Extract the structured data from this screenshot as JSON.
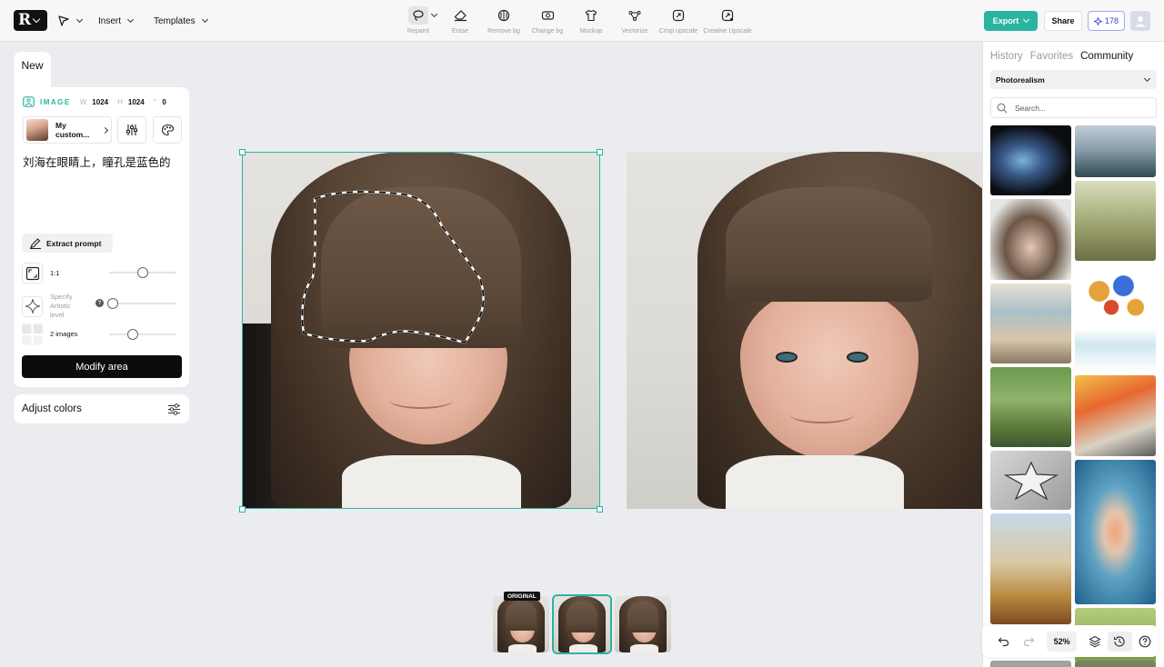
{
  "topbar": {
    "menus": [
      {
        "label": ""
      },
      {
        "label": "Insert"
      },
      {
        "label": "Templates"
      }
    ],
    "tools": [
      {
        "label": "Repaint",
        "icon": "lasso-icon"
      },
      {
        "label": "Erase",
        "icon": "eraser-icon"
      },
      {
        "label": "Remove bg",
        "icon": "remove-bg-icon"
      },
      {
        "label": "Change bg",
        "icon": "change-bg-icon"
      },
      {
        "label": "Mockup",
        "icon": "shirt-icon"
      },
      {
        "label": "Vectorize",
        "icon": "vector-nodes-icon"
      },
      {
        "label": "Crisp upscale",
        "icon": "upscale-icon"
      },
      {
        "label": "Creative Upscale",
        "icon": "creative-upscale-icon"
      }
    ],
    "export_label": "Export",
    "share_label": "Share",
    "credits": "178"
  },
  "left": {
    "new_tab": "New",
    "image_keyword": "IMAGE",
    "w_label": "W",
    "w_value": "1024",
    "h_label": "H",
    "h_value": "1024",
    "r_value": "0",
    "style_name": "My custom...",
    "prompt": "刘海在眼睛上，瞳孔是蓝色的",
    "extract_label": "Extract prompt",
    "ratio_label": "1:1",
    "artistic_label": "Specify Artistic level",
    "images_label": "2 images",
    "modify_label": "Modify area",
    "adjust_label": "Adjust colors",
    "sliders": {
      "ratio": 0.5,
      "artistic": 0.05,
      "images": 0.35
    }
  },
  "canvas": {
    "original_badge": "ORIGINAL",
    "selected_index": 1
  },
  "right": {
    "tabs": [
      "History",
      "Favorites",
      "Community"
    ],
    "active_tab": "Community",
    "style_select": "Photorealism",
    "search_placeholder": "Search...",
    "zoom": "52%"
  },
  "colors": {
    "accent": "#2ab3a0",
    "credits": "#3b46d8",
    "primary_button": "#0c0c0d"
  }
}
